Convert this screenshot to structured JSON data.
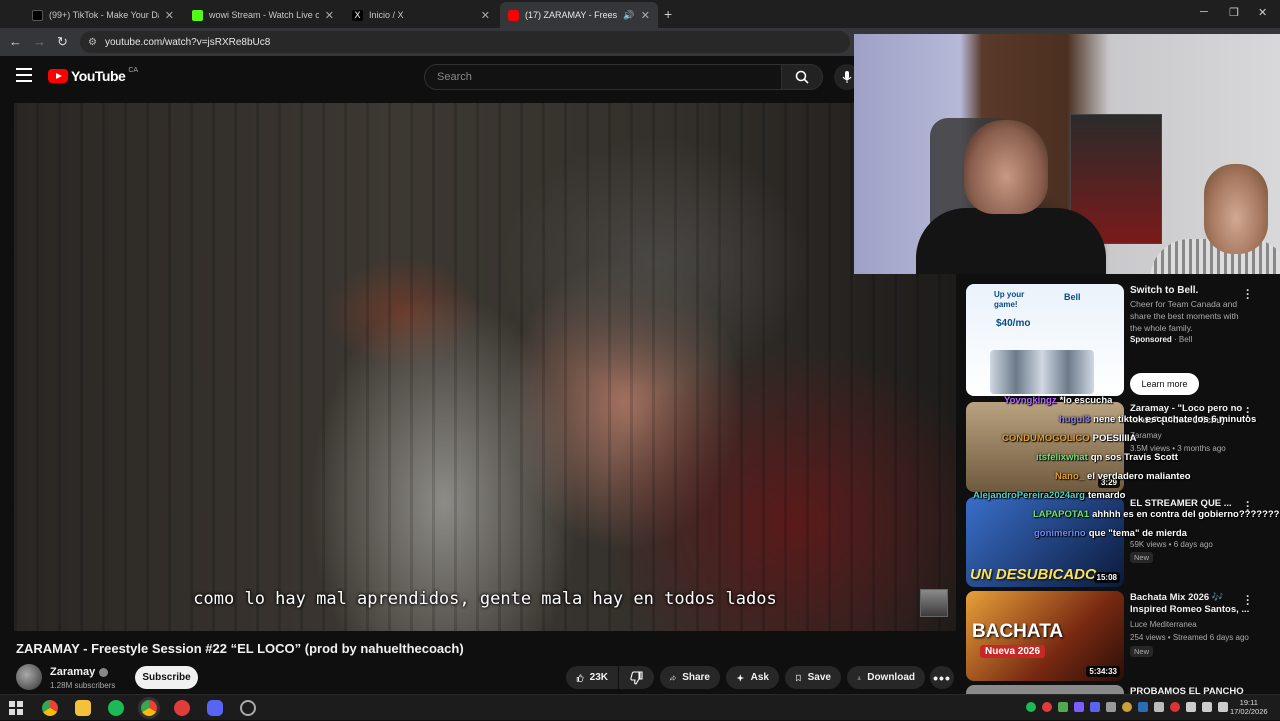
{
  "browser": {
    "tabs": [
      {
        "title": "(99+) TikTok - Make Your Day",
        "favicon_color": "#000000"
      },
      {
        "title": "wowi Stream - Watch Live on Kick",
        "favicon_color": "#53fc18"
      },
      {
        "title": "Inicio / X",
        "favicon_color": "#000000"
      },
      {
        "title": "(17) ZARAMAY - Freestyle Session",
        "favicon_color": "#ff0000"
      }
    ],
    "url": "youtube.com/watch?v=jsRXRe8bUc8"
  },
  "youtube": {
    "logo": "YouTube",
    "region": "CA",
    "search_placeholder": "Search"
  },
  "video": {
    "subtitle": "como lo hay mal aprendidos, gente mala hay en todos lados",
    "title": "ZARAMAY - Freestyle Session #22 “EL LOCO” (prod by nahuelthecoach)",
    "channel": "Zaramay",
    "subscribers": "1.28M subscribers",
    "subscribe_label": "Subscribe",
    "likes": "23K",
    "share_label": "Share",
    "ask_label": "Ask",
    "save_label": "Save",
    "download_label": "Download"
  },
  "ad": {
    "image_text": "Up your game!",
    "image_price": "$40/mo",
    "brand_logo": "Bell",
    "title": "Switch to Bell.",
    "description": "Cheer for Team Canada and share the best moments with the whole family.",
    "sponsored": "Sponsored",
    "advertiser": "Bell",
    "cta": "Learn more"
  },
  "recommendations": [
    {
      "title": "Zaramay - \"Loco pero no tonto\" (Video Oficial)",
      "channel": "Zaramay",
      "meta": "3.5M views • 3 months ago",
      "duration": "3:29",
      "badge": ""
    },
    {
      "title": "EL STREAMER QUE ...",
      "channel": "",
      "meta": "59K views • 6 days ago",
      "duration": "15:08",
      "thumb_text": "UN DESUBICADO",
      "badge": "New"
    },
    {
      "title": "Bachata Mix 2026 🎶 Inspired Romeo Santos, ...",
      "channel": "Luce Mediterranea",
      "meta": "254 views • Streamed 6 days ago",
      "duration": "5:34:33",
      "thumb_text": "BACHATA",
      "thumb_sub": "Nueva 2026",
      "badge": "New"
    },
    {
      "title": "PROBAMOS EL PANCHO",
      "channel": "",
      "meta": "",
      "duration": ""
    }
  ],
  "chat": [
    {
      "user": "Yovngkingz",
      "msg": "*lo escucha",
      "color": "#b46bff"
    },
    {
      "user": "hugui3",
      "msg": "nene tiktok escuchate los 6 minutos",
      "color": "#8a7bff"
    },
    {
      "user": "CONDUMOGOLICO",
      "msg": "POESIIIIA",
      "color": "#e0a030"
    },
    {
      "user": "itsfelixwhat",
      "msg": "qn sos Travis Scott",
      "color": "#6ee06e"
    },
    {
      "user": "Nano_",
      "msg": "el verdadero malianteo",
      "color": "#e0a030"
    },
    {
      "user": "AlejandroPereira2024arg",
      "msg": "temardo",
      "color": "#4ad6c6"
    },
    {
      "user": "LAPAPOTA1",
      "msg": "ahhhh es en contra del gobierno??????????",
      "color": "#6ee06e"
    },
    {
      "user": "gonimerino",
      "msg": "que \"tema\" de mierda",
      "color": "#6a8bff"
    }
  ],
  "taskbar": {
    "time": "19:11",
    "date": "17/02/2026"
  }
}
